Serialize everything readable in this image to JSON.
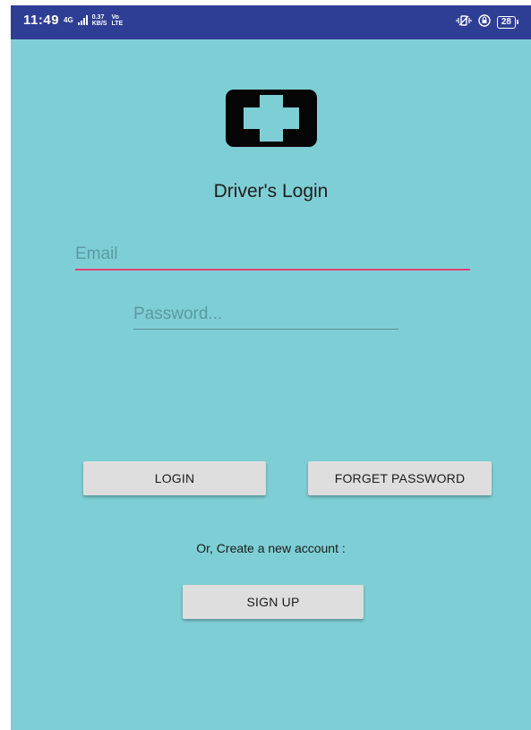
{
  "status_bar": {
    "time": "11:49",
    "network_type": "4G",
    "speed_value": "0.37",
    "speed_unit": "KB/S",
    "volte_top": "Vo",
    "volte_bottom": "LTE",
    "battery_level": "28",
    "background_color": "#2f3e95"
  },
  "app": {
    "background_color": "#7ecfd5",
    "logo_icon": "medical-cross-icon",
    "title": "Driver's Login",
    "email": {
      "placeholder": "Email",
      "value": ""
    },
    "password": {
      "placeholder": "Password...",
      "value": ""
    },
    "login_label": "LOGIN",
    "forget_password_label": "FORGET PASSWORD",
    "create_account_text": "Or, Create a new account :",
    "signup_label": "SIGN UP"
  }
}
